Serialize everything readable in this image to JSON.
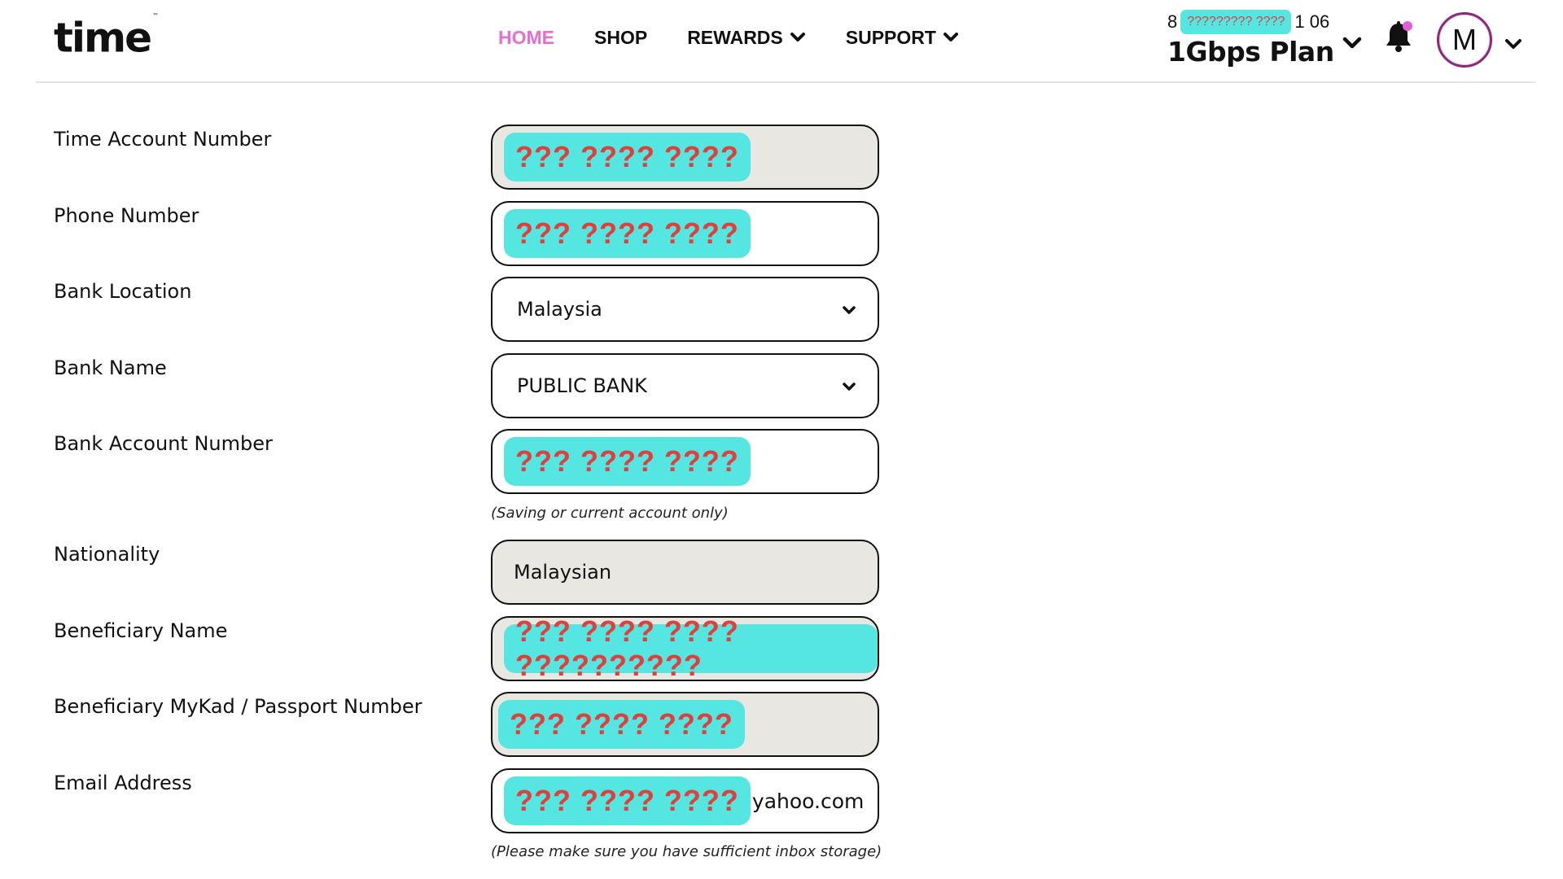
{
  "header": {
    "logo": "time",
    "logo_mark": "™",
    "nav": [
      {
        "label": "HOME",
        "active": true,
        "has_dropdown": false
      },
      {
        "label": "SHOP",
        "active": false,
        "has_dropdown": false
      },
      {
        "label": "REWARDS",
        "active": false,
        "has_dropdown": true
      },
      {
        "label": "SUPPORT",
        "active": false,
        "has_dropdown": true
      }
    ],
    "account": {
      "number_prefix": "8",
      "number_redacted": "????????? ????",
      "number_suffix": "1 06",
      "plan": "1Gbps Plan"
    },
    "notification_icon": "bell-icon",
    "notification_dot_color": "#e45fd2",
    "avatar_initial": "M"
  },
  "colors": {
    "accent": "#e46fd0",
    "redaction_bg": "#55e6e2",
    "redaction_text": "#e0403c",
    "readonly_bg": "#e8e7e2"
  },
  "form": {
    "fields": [
      {
        "label": "Time Account Number",
        "type": "text",
        "readonly": true,
        "redacted": "??? ???? ????"
      },
      {
        "label": "Phone Number",
        "type": "text",
        "readonly": false,
        "redacted": "??? ???? ????"
      },
      {
        "label": "Bank Location",
        "type": "select",
        "readonly": false,
        "value": "Malaysia"
      },
      {
        "label": "Bank Name",
        "type": "select",
        "readonly": false,
        "value": "PUBLIC BANK"
      },
      {
        "label": "Bank Account Number",
        "type": "text",
        "readonly": false,
        "redacted": "??? ???? ????",
        "helper": "(Saving or current account only)"
      },
      {
        "label": "Nationality",
        "type": "text",
        "readonly": true,
        "value": "Malaysian"
      },
      {
        "label": "Beneficiary Name",
        "type": "text",
        "readonly": true,
        "redacted": "??? ???? ???? ??????????"
      },
      {
        "label": "Beneficiary MyKad / Passport Number",
        "type": "text",
        "readonly": true,
        "redacted": "??? ???? ????"
      },
      {
        "label": "Email Address",
        "type": "text",
        "readonly": false,
        "redacted": "??? ???? ????",
        "suffix": "yahoo.com",
        "helper": "(Please make sure you have sufficient inbox storage)"
      }
    ]
  }
}
